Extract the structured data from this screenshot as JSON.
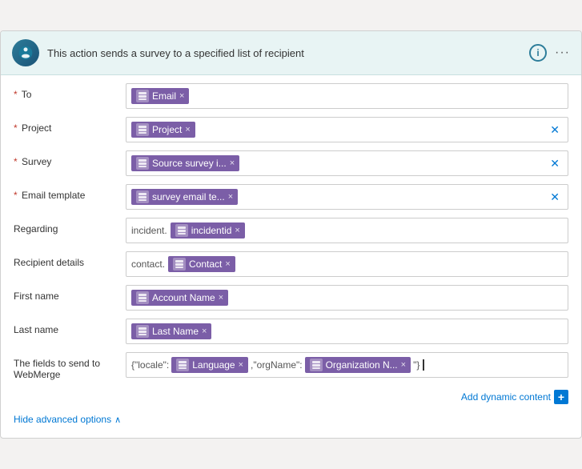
{
  "header": {
    "title": "This action sends a survey to a specified list of recipient",
    "info_label": "i",
    "more_label": "···"
  },
  "fields": {
    "to": {
      "label": "To",
      "required": true,
      "tags": [
        {
          "icon": "db-icon",
          "text": "Email",
          "closable": true
        }
      ],
      "clearable": false
    },
    "project": {
      "label": "Project",
      "required": true,
      "tags": [
        {
          "icon": "db-icon",
          "text": "Project",
          "closable": true
        }
      ],
      "clearable": true
    },
    "survey": {
      "label": "Survey",
      "required": true,
      "tags": [
        {
          "icon": "db-icon",
          "text": "Source survey i...",
          "closable": true
        }
      ],
      "clearable": true
    },
    "email_template": {
      "label": "Email template",
      "required": true,
      "tags": [
        {
          "icon": "db-icon",
          "text": "survey email te...",
          "closable": true
        }
      ],
      "clearable": true
    },
    "regarding": {
      "label": "Regarding",
      "required": false,
      "prefix": "incident.",
      "tags": [
        {
          "icon": "db-icon",
          "text": "incidentid",
          "closable": true
        }
      ],
      "clearable": false
    },
    "recipient_details": {
      "label": "Recipient details",
      "required": false,
      "prefix": "contact.",
      "tags": [
        {
          "icon": "db-icon",
          "text": "Contact",
          "closable": true
        }
      ],
      "clearable": false
    },
    "first_name": {
      "label": "First name",
      "required": false,
      "tags": [
        {
          "icon": "db-icon",
          "text": "Account Name",
          "closable": true
        }
      ],
      "clearable": false
    },
    "last_name": {
      "label": "Last name",
      "required": false,
      "tags": [
        {
          "icon": "db-icon",
          "text": "Last Name",
          "closable": true
        }
      ],
      "clearable": false
    },
    "webmerge": {
      "label": "The fields to send to WebMerge",
      "required": false,
      "prefix1": "{\"locale\":",
      "tags1": [
        {
          "icon": "db-icon",
          "text": "Language",
          "closable": true
        }
      ],
      "infix": ",\"orgName\":",
      "tags2": [
        {
          "icon": "db-icon",
          "text": "Organization N...",
          "closable": true
        }
      ],
      "suffix": "\"}"
    }
  },
  "footer": {
    "add_dynamic_label": "Add dynamic content",
    "hide_advanced_label": "Hide advanced options"
  },
  "icons": {
    "db": "🗄",
    "clear_x": "✕",
    "tag_close": "×",
    "info": "i",
    "more": "···",
    "plus": "+",
    "chevron_up": "∧"
  }
}
